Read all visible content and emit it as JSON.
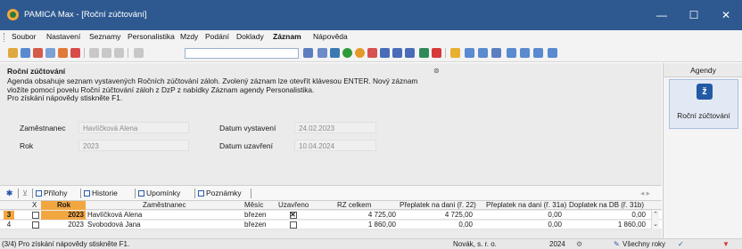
{
  "window": {
    "app_name": "PAMICA Max - [Roční zúčtování]",
    "minimize": "—",
    "maximize": "☐",
    "close": "✕"
  },
  "menu": [
    "Soubor",
    "Nastavení",
    "Seznamy",
    "Personalistika",
    "Mzdy",
    "Podání",
    "Doklady",
    "Záznam",
    "Nápověda"
  ],
  "menu_active": "Záznam",
  "info": {
    "title": "Roční zúčtování",
    "lines": [
      "Agenda obsahuje seznam vystavených Ročních zúčtování záloh. Zvolený záznam lze otevřít klávesou ENTER. Nový záznam",
      "vložíte pomocí povelu Roční zúčtování záloh z DzP z nabídky Záznam agendy Personalistika.",
      "Pro získání nápovědy stiskněte F1."
    ]
  },
  "fields": {
    "zamestnanec_label": "Zaměstnanec",
    "zamestnanec_value": "Havlíčková Alena",
    "rok_label": "Rok",
    "rok_value": "2023",
    "datum_vystaveni_label": "Datum vystavení",
    "datum_vystaveni_value": "24.02.2023",
    "datum_uzavreni_label": "Datum uzavření",
    "datum_uzavreni_value": "10.04.2024"
  },
  "tabs": [
    "Přílohy",
    "Historie",
    "Upomínky",
    "Poznámky"
  ],
  "grid": {
    "columns": [
      "X",
      "Rok",
      "Zaměstnanec",
      "Měsíc",
      "Uzavřeno",
      "RZ celkem",
      "Přeplatek na dani (ř. 22)",
      "Přeplatek na dani (ř. 31a)",
      "Doplatek na DB (ř. 31b)"
    ],
    "rows": [
      {
        "no": "3",
        "rok": "2023",
        "zamestnanec": "Havlíčková Alena",
        "mesic": "březen",
        "uzavreno": true,
        "rz_celkem": "4 725,00",
        "preplatek22": "4 725,00",
        "preplatek31a": "0,00",
        "doplatek31b": "0,00"
      },
      {
        "no": "4",
        "rok": "2023",
        "zamestnanec": "Svobodová Jana",
        "mesic": "březen",
        "uzavreno": false,
        "rz_celkem": "1 860,00",
        "preplatek22": "0,00",
        "preplatek31a": "0,00",
        "doplatek31b": "1 860,00"
      }
    ]
  },
  "agenda": {
    "header": "Agendy",
    "item_label": "Roční zúčtování"
  },
  "status": {
    "hint": "(3/4) Pro získání nápovědy stiskněte F1.",
    "company": "Novák, s. r. o.",
    "year": "2024",
    "filter": "Všechny roky"
  }
}
